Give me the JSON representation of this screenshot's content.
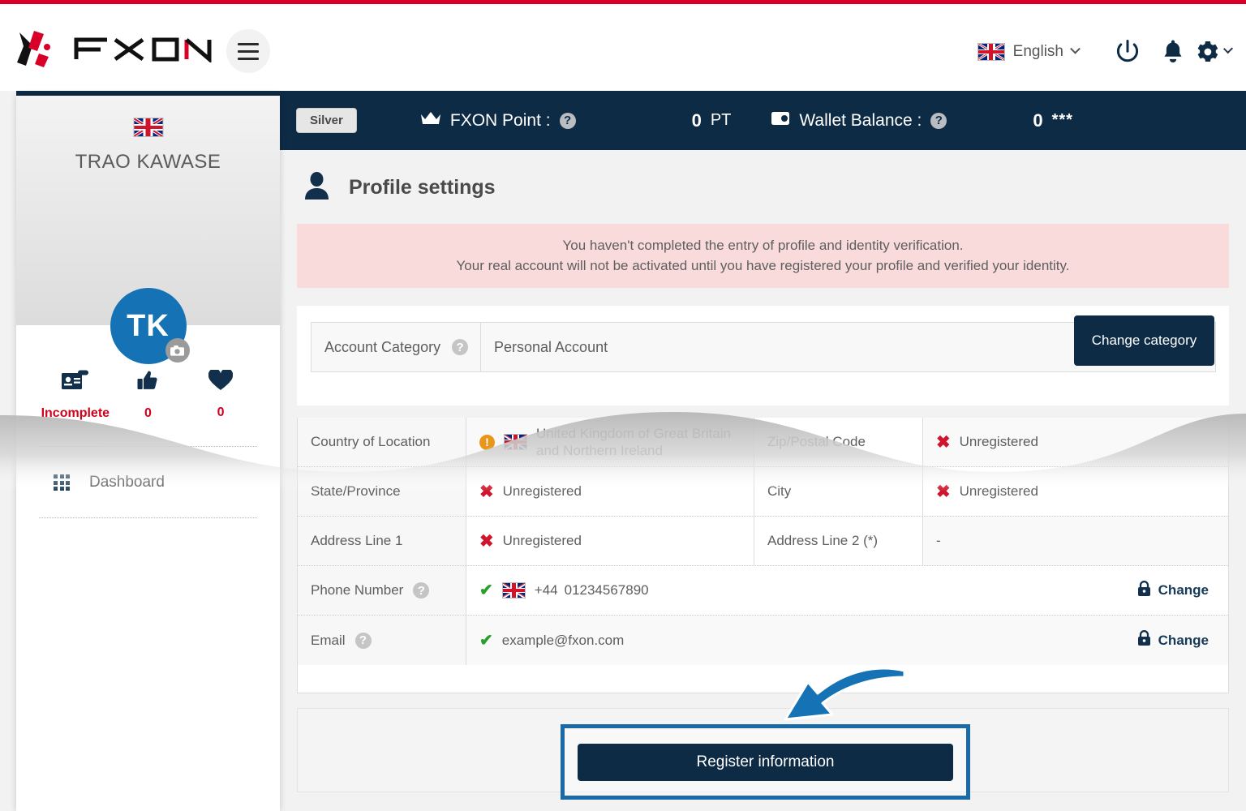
{
  "brand": {
    "name": "FXON",
    "accent": "#d80027",
    "navy": "#0d2b45"
  },
  "header": {
    "language": "English",
    "icons": [
      "power-icon",
      "bell-icon",
      "gear-icon"
    ],
    "flag": "uk-flag"
  },
  "status_bar": {
    "rank_badge": "Silver",
    "point_label": "FXON Point :",
    "point_value": "0",
    "point_unit": "PT",
    "wallet_label": "Wallet Balance :",
    "wallet_value": "0",
    "wallet_masked": "***"
  },
  "sidebar": {
    "user_name": "TRAO KAWASE",
    "avatar_initials": "TK",
    "stats": [
      {
        "icon": "id-card-icon",
        "label": "Incomplete"
      },
      {
        "icon": "thumbs-up-icon",
        "label": "0"
      },
      {
        "icon": "heart-icon",
        "label": "0"
      }
    ],
    "nav": [
      {
        "icon": "grid-icon",
        "label": "Dashboard"
      }
    ]
  },
  "main": {
    "page_title": "Profile settings",
    "alert": {
      "line1": "You haven't completed the entry of profile and identity verification.",
      "line2": "Your real account will not be activated until you have registered your profile and verified your identity."
    },
    "account_category": {
      "label": "Account Category",
      "value": "Personal Account",
      "button": "Change category"
    },
    "table": {
      "rows": [
        {
          "label1": "Country of Location",
          "status1": "warning",
          "flag1": true,
          "value1": "United Kingdom of Great Britain and Northern Ireland",
          "label2": "Zip/Postal Code",
          "status2": "cross",
          "value2": "Unregistered"
        },
        {
          "label1": "State/Province",
          "status1": "cross",
          "value1": "Unregistered",
          "label2": "City",
          "status2": "cross",
          "value2": "Unregistered"
        },
        {
          "label1": "Address Line 1",
          "status1": "cross",
          "value1": "Unregistered",
          "label2": "Address Line 2 (*)",
          "status2": "none",
          "value2": "-"
        }
      ],
      "phone": {
        "label": "Phone Number",
        "status": "check",
        "code": "+44",
        "number": "01234567890",
        "action": "Change"
      },
      "email": {
        "label": "Email",
        "status": "check",
        "value": "example@fxon.com",
        "action": "Change"
      }
    },
    "register_button": "Register information"
  }
}
